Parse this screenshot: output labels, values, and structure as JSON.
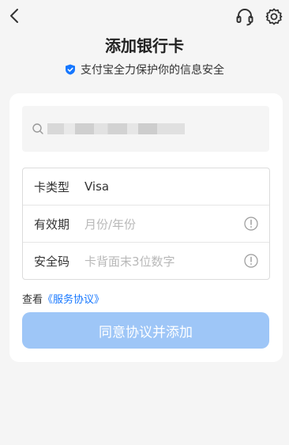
{
  "header": {
    "back_icon": "chevron-left-icon",
    "support_icon": "headset-icon",
    "settings_icon": "gear-icon",
    "title": "添加银行卡",
    "security_note": "支付宝全力保护你的信息安全",
    "security_icon": "shield-check-icon"
  },
  "search": {
    "icon": "search-icon",
    "value_obscured": true
  },
  "form": {
    "rows": [
      {
        "label": "卡类型",
        "value": "Visa",
        "placeholder": ""
      },
      {
        "label": "有效期",
        "value": "",
        "placeholder": "月份/年份"
      },
      {
        "label": "安全码",
        "value": "",
        "placeholder": "卡背面末3位数字"
      }
    ]
  },
  "agreement": {
    "prefix": "查看",
    "link": "《服务协议》"
  },
  "submit": {
    "label": "同意协议并添加"
  },
  "colors": {
    "accent": "#1677ff",
    "button_disabled": "#9ec6f7",
    "background": "#f5f5f5"
  }
}
